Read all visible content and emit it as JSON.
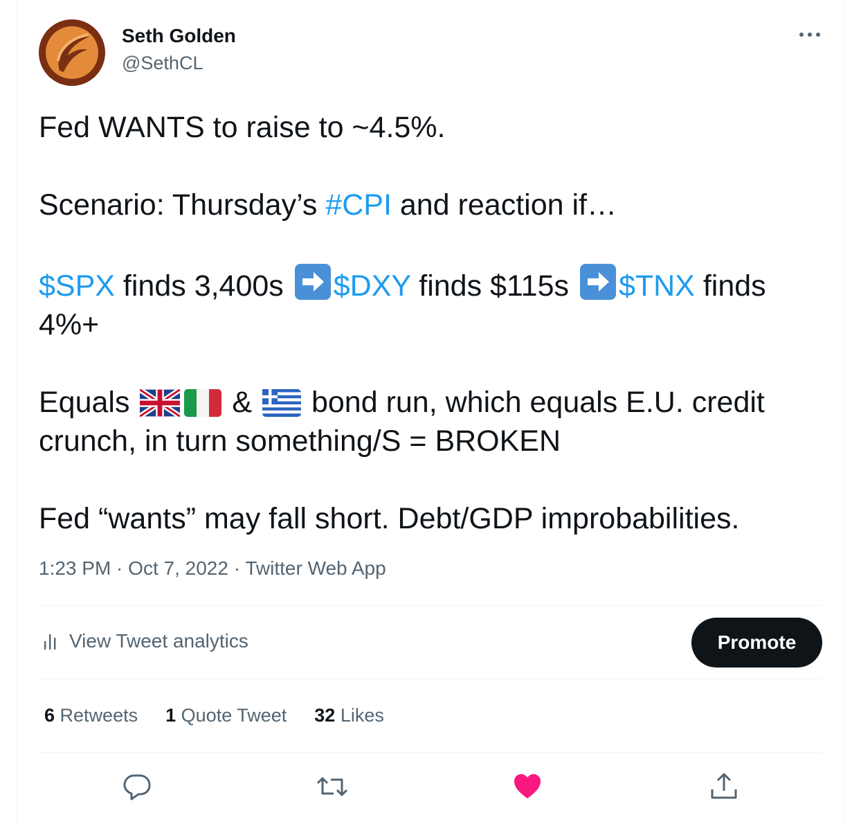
{
  "author": {
    "name": "Seth Golden",
    "handle": "@SethCL"
  },
  "tweet": {
    "p1": "Fed WANTS to raise to ~4.5%.",
    "p2_a": "Scenario: Thursday’s ",
    "p2_tag": "#CPI",
    "p2_b": " and reaction if…",
    "p3_spx": "$SPX",
    "p3_a": " finds 3,400s ",
    "p3_dxy": "$DXY",
    "p3_b": " finds $115s ",
    "p3_tnx": "$TNX",
    "p3_c": " finds 4%+",
    "p4_a": "Equals ",
    "p4_amp": " & ",
    "p4_b": " bond run, which equals E.U. credit crunch, in turn something/S = BROKEN",
    "p5": "Fed “wants” may fall short. Debt/GDP improbabilities."
  },
  "meta": {
    "time": "1:23 PM",
    "date": "Oct 7, 2022",
    "source": "Twitter Web App",
    "sep": " · "
  },
  "analytics_label": "View Tweet analytics",
  "promote_label": "Promote",
  "stats": {
    "retweets_count": "6",
    "retweets_label": "Retweets",
    "quotes_count": "1",
    "quotes_label": "Quote Tweet",
    "likes_count": "32",
    "likes_label": "Likes"
  },
  "colors": {
    "link": "#1d9bf0",
    "like": "#f91880",
    "muted": "#536471"
  }
}
